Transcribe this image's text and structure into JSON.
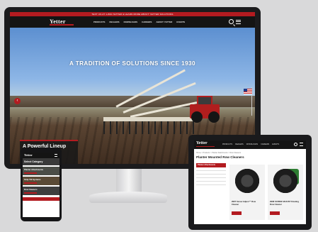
{
  "desktop": {
    "topbar_text": "TEXT US AT 1-800-YETTER & LEARN MORE ABOUT YETTER SOLUTIONS",
    "logo": "Yetter",
    "nav_items": [
      "PRODUCTS",
      "DEALERS",
      "DOWNLOADS",
      "CAREERS",
      "ABOUT YETTER",
      "EVENTS"
    ],
    "hero_title": "A TRADITION OF SOLUTIONS SINCE 1930",
    "lineup_text": "A Powerful Lineup",
    "prev_arrow": "‹"
  },
  "phone": {
    "logo": "Yetter",
    "title": "Select Category",
    "items": [
      "Planter Attachments",
      "Strip Till Systems",
      "Row Cleaners"
    ]
  },
  "tablet": {
    "logo": "Yetter",
    "links": [
      "PRODUCTS",
      "DEALERS",
      "DOWNLOADS",
      "CAREERS",
      "EVENTS"
    ],
    "crumb": "Home > Products > Planter Attachments > Row Cleaners",
    "title": "Planter Mounted Row Cleaners",
    "side_head": "Planter Attachments",
    "cards": [
      {
        "name": "2967 Screw Adjust™ Row Cleaner"
      },
      {
        "name": "2968 SCREW ADJUST Floating Row Cleaner"
      }
    ]
  },
  "colors": {
    "brand_red": "#b31b20",
    "nav_black": "#141414"
  }
}
